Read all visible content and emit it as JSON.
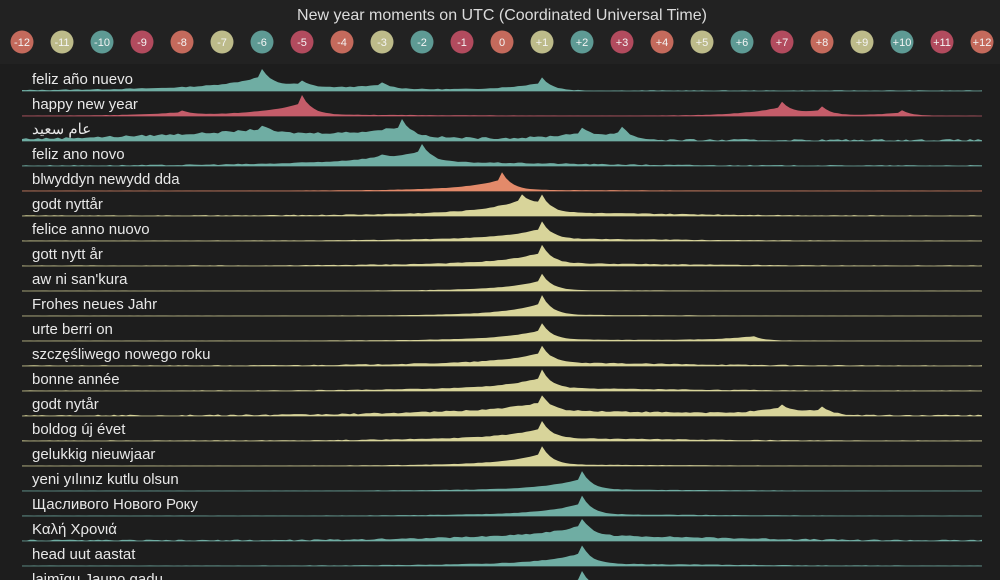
{
  "chart_data": {
    "type": "area",
    "title": "New year moments on UTC (Coordinated Universal Time)",
    "timezones": [
      {
        "label": "-12",
        "color": "#c46a5c"
      },
      {
        "label": "-11",
        "color": "#bdbb8a"
      },
      {
        "label": "-10",
        "color": "#5e9a94"
      },
      {
        "label": "-9",
        "color": "#b24b5e"
      },
      {
        "label": "-8",
        "color": "#c46a5c"
      },
      {
        "label": "-7",
        "color": "#bdbb8a"
      },
      {
        "label": "-6",
        "color": "#5e9a94"
      },
      {
        "label": "-5",
        "color": "#b24b5e"
      },
      {
        "label": "-4",
        "color": "#c46a5c"
      },
      {
        "label": "-3",
        "color": "#bdbb8a"
      },
      {
        "label": "-2",
        "color": "#5e9a94"
      },
      {
        "label": "-1",
        "color": "#b24b5e"
      },
      {
        "label": "0",
        "color": "#c46a5c"
      },
      {
        "label": "+1",
        "color": "#bdbb8a"
      },
      {
        "label": "+2",
        "color": "#5e9a94"
      },
      {
        "label": "+3",
        "color": "#b24b5e"
      },
      {
        "label": "+4",
        "color": "#c46a5c"
      },
      {
        "label": "+5",
        "color": "#bdbb8a"
      },
      {
        "label": "+6",
        "color": "#5e9a94"
      },
      {
        "label": "+7",
        "color": "#b24b5e"
      },
      {
        "label": "+8",
        "color": "#c46a5c"
      },
      {
        "label": "+9",
        "color": "#bdbb8a"
      },
      {
        "label": "+10",
        "color": "#5e9a94"
      },
      {
        "label": "+11",
        "color": "#b24b5e"
      },
      {
        "label": "+12",
        "color": "#c46a5c"
      }
    ],
    "x_range": [
      -12,
      12
    ],
    "series": [
      {
        "name": "feliz año nuevo",
        "color": "#6fada3",
        "peaks": [
          [
            -6,
            0.8
          ],
          [
            -5,
            0.3
          ],
          [
            -3,
            0.3
          ],
          [
            1,
            0.6
          ]
        ],
        "base": 0.12
      },
      {
        "name": "happy new year",
        "color": "#c45c69",
        "peaks": [
          [
            -5,
            0.9
          ],
          [
            -8,
            0.2
          ],
          [
            7,
            0.55
          ],
          [
            8,
            0.4
          ],
          [
            10,
            0.25
          ]
        ],
        "base": 0.05
      },
      {
        "name": "عام سعيد",
        "color": "#6fada3",
        "peaks": [
          [
            -6,
            0.35
          ],
          [
            -2.5,
            0.8
          ],
          [
            2,
            0.4
          ],
          [
            3,
            0.6
          ]
        ],
        "base": 0.3
      },
      {
        "name": "feliz ano novo",
        "color": "#6fada3",
        "peaks": [
          [
            -2,
            0.85
          ],
          [
            -3,
            0.2
          ]
        ],
        "base": 0.15
      },
      {
        "name": "blwyddyn newydd dda",
        "color": "#e38a6a",
        "peaks": [
          [
            0,
            0.8
          ]
        ],
        "base": 0.04
      },
      {
        "name": "godt nyttår",
        "color": "#d8d49a",
        "peaks": [
          [
            1,
            0.75
          ],
          [
            0.5,
            0.6
          ]
        ],
        "base": 0.12
      },
      {
        "name": "felice anno nuovo",
        "color": "#d8d49a",
        "peaks": [
          [
            1,
            0.8
          ]
        ],
        "base": 0.08
      },
      {
        "name": "gott nytt år",
        "color": "#d8d49a",
        "peaks": [
          [
            1,
            0.85
          ]
        ],
        "base": 0.1
      },
      {
        "name": "aw ni san'kura",
        "color": "#d8d49a",
        "peaks": [
          [
            1,
            0.75
          ]
        ],
        "base": 0.03
      },
      {
        "name": "Frohes neues Jahr",
        "color": "#d8d49a",
        "peaks": [
          [
            1,
            0.9
          ]
        ],
        "base": 0.04
      },
      {
        "name": "urte berri on",
        "color": "#d8d49a",
        "peaks": [
          [
            1,
            0.75
          ],
          [
            6.2,
            0.3
          ]
        ],
        "base": 0.05
      },
      {
        "name": "szczęśliwego nowego roku",
        "color": "#d8d49a",
        "peaks": [
          [
            1,
            0.8
          ]
        ],
        "base": 0.12
      },
      {
        "name": "bonne année",
        "color": "#d8d49a",
        "peaks": [
          [
            1,
            0.85
          ]
        ],
        "base": 0.1
      },
      {
        "name": "godt nytår",
        "color": "#d8d49a",
        "peaks": [
          [
            1,
            0.7
          ],
          [
            7,
            0.4
          ],
          [
            8,
            0.4
          ]
        ],
        "base": 0.2
      },
      {
        "name": "boldog új évet",
        "color": "#d8d49a",
        "peaks": [
          [
            1,
            0.8
          ]
        ],
        "base": 0.1
      },
      {
        "name": "gelukkig nieuwjaar",
        "color": "#d8d49a",
        "peaks": [
          [
            1,
            0.85
          ]
        ],
        "base": 0.05
      },
      {
        "name": "yeni yılınız kutlu olsun",
        "color": "#6fada3",
        "peaks": [
          [
            2,
            0.85
          ]
        ],
        "base": 0.05
      },
      {
        "name": "Щасливого Нового Року",
        "color": "#6fada3",
        "peaks": [
          [
            2,
            0.85
          ]
        ],
        "base": 0.06
      },
      {
        "name": "Καλή Χρονιά",
        "color": "#6fada3",
        "peaks": [
          [
            2,
            0.8
          ]
        ],
        "base": 0.2
      },
      {
        "name": "head uut aastat",
        "color": "#6fada3",
        "peaks": [
          [
            2,
            0.85
          ]
        ],
        "base": 0.08
      },
      {
        "name": "laimīgu Jauno gadu",
        "color": "#6fada3",
        "peaks": [
          [
            2,
            0.85
          ]
        ],
        "base": 0.05
      }
    ]
  }
}
